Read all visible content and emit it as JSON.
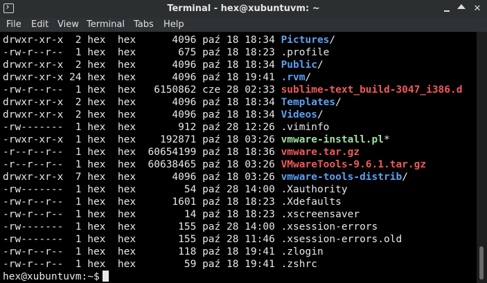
{
  "window": {
    "title": "Terminal - hex@xubuntuvm: ~",
    "icon": "terminal-icon"
  },
  "menu": [
    "File",
    "Edit",
    "View",
    "Terminal",
    "Tabs",
    "Help"
  ],
  "rows": [
    {
      "perm": "drwxr-xr-x",
      "links": " 2",
      "user": "hex",
      "group": "hex",
      "size": "   4096",
      "month": "paź",
      "day": "18",
      "time": "18:34",
      "name": "Pictures",
      "suffix": "/",
      "kind": "dir"
    },
    {
      "perm": "-rw-r--r--",
      "links": " 1",
      "user": "hex",
      "group": "hex",
      "size": "    675",
      "month": "paź",
      "day": "18",
      "time": "18:23",
      "name": ".profile",
      "suffix": "",
      "kind": "plain"
    },
    {
      "perm": "drwxr-xr-x",
      "links": " 2",
      "user": "hex",
      "group": "hex",
      "size": "   4096",
      "month": "paź",
      "day": "18",
      "time": "18:34",
      "name": "Public",
      "suffix": "/",
      "kind": "dir"
    },
    {
      "perm": "drwxr-xr-x",
      "links": "24",
      "user": "hex",
      "group": "hex",
      "size": "   4096",
      "month": "paź",
      "day": "18",
      "time": "19:41",
      "name": ".rvm",
      "suffix": "/",
      "kind": "dir"
    },
    {
      "perm": "-rw-r--r--",
      "links": " 1",
      "user": "hex",
      "group": "hex",
      "size": "6150862",
      "month": "cze",
      "day": "28",
      "time": "02:33",
      "name": "sublime-text_build-3047_i386.d",
      "suffix": "",
      "kind": "red"
    },
    {
      "perm": "drwxr-xr-x",
      "links": " 2",
      "user": "hex",
      "group": "hex",
      "size": "   4096",
      "month": "paź",
      "day": "18",
      "time": "18:34",
      "name": "Templates",
      "suffix": "/",
      "kind": "dir"
    },
    {
      "perm": "drwxr-xr-x",
      "links": " 2",
      "user": "hex",
      "group": "hex",
      "size": "   4096",
      "month": "paź",
      "day": "18",
      "time": "18:34",
      "name": "Videos",
      "suffix": "/",
      "kind": "dir"
    },
    {
      "perm": "-rw-------",
      "links": " 1",
      "user": "hex",
      "group": "hex",
      "size": "    912",
      "month": "paź",
      "day": "28",
      "time": "12:26",
      "name": ".viminfo",
      "suffix": "",
      "kind": "plain"
    },
    {
      "perm": "-rwxr-xr-x",
      "links": " 1",
      "user": "hex",
      "group": "hex",
      "size": " 192871",
      "month": "paź",
      "day": "18",
      "time": "03:26",
      "name": "vmware-install.pl",
      "suffix": "*",
      "kind": "exec"
    },
    {
      "perm": "-r--r--r--",
      "links": " 1",
      "user": "hex",
      "group": "hex",
      "size": "60654199",
      "month": "paź",
      "day": "18",
      "time": "18:36",
      "name": "vmware.tar.gz",
      "suffix": "",
      "kind": "red"
    },
    {
      "perm": "-r--r--r--",
      "links": " 1",
      "user": "hex",
      "group": "hex",
      "size": "60638465",
      "month": "paź",
      "day": "18",
      "time": "03:26",
      "name": "VMwareTools-9.6.1.tar.gz",
      "suffix": "",
      "kind": "red"
    },
    {
      "perm": "drwxr-xr-x",
      "links": " 7",
      "user": "hex",
      "group": "hex",
      "size": "   4096",
      "month": "paź",
      "day": "18",
      "time": "03:26",
      "name": "vmware-tools-distrib",
      "suffix": "/",
      "kind": "dir"
    },
    {
      "perm": "-rw-------",
      "links": " 1",
      "user": "hex",
      "group": "hex",
      "size": "     54",
      "month": "paź",
      "day": "28",
      "time": "14:00",
      "name": ".Xauthority",
      "suffix": "",
      "kind": "plain"
    },
    {
      "perm": "-rw-r--r--",
      "links": " 1",
      "user": "hex",
      "group": "hex",
      "size": "   1601",
      "month": "paź",
      "day": "18",
      "time": "18:23",
      "name": ".Xdefaults",
      "suffix": "",
      "kind": "plain"
    },
    {
      "perm": "-rw-r--r--",
      "links": " 1",
      "user": "hex",
      "group": "hex",
      "size": "     14",
      "month": "paź",
      "day": "18",
      "time": "18:23",
      "name": ".xscreensaver",
      "suffix": "",
      "kind": "plain"
    },
    {
      "perm": "-rw-------",
      "links": " 1",
      "user": "hex",
      "group": "hex",
      "size": "    155",
      "month": "paź",
      "day": "28",
      "time": "14:00",
      "name": ".xsession-errors",
      "suffix": "",
      "kind": "plain"
    },
    {
      "perm": "-rw-------",
      "links": " 1",
      "user": "hex",
      "group": "hex",
      "size": "    155",
      "month": "paź",
      "day": "28",
      "time": "11:46",
      "name": ".xsession-errors.old",
      "suffix": "",
      "kind": "plain"
    },
    {
      "perm": "-rw-r--r--",
      "links": " 1",
      "user": "hex",
      "group": "hex",
      "size": "    118",
      "month": "paź",
      "day": "18",
      "time": "19:41",
      "name": ".zlogin",
      "suffix": "",
      "kind": "plain"
    },
    {
      "perm": "-rw-r--r--",
      "links": " 1",
      "user": "hex",
      "group": "hex",
      "size": "     59",
      "month": "paź",
      "day": "18",
      "time": "19:41",
      "name": ".zshrc",
      "suffix": "",
      "kind": "plain"
    }
  ],
  "prompt": "hex@xubuntuvm:~$",
  "colors": {
    "dir": "#5ea0f0",
    "archive": "#ef5a5a",
    "executable": "#9fe09f",
    "text": "#e8e8e8",
    "background": "#000000"
  }
}
